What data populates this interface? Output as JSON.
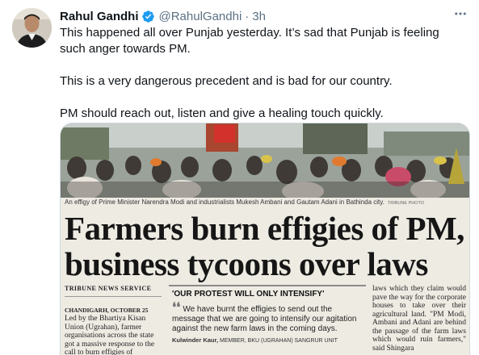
{
  "tweet": {
    "author": {
      "display_name": "Rahul Gandhi",
      "handle": "@RahulGandhi",
      "verified_icon": "verified-badge-icon",
      "verified_color": "#1d9bf0"
    },
    "separator": "·",
    "timestamp": "3h",
    "more_icon": "more-horizontal-icon",
    "paragraphs": [
      "This happened all over Punjab yesterday. It’s sad that Punjab is feeling such anger towards PM.",
      "This is a very dangerous precedent and is bad for our country.",
      "PM should reach out, listen and give a healing touch quickly."
    ]
  },
  "media": {
    "caption": "An effigy of Prime Minister Narendra Modi and industrialists Mukesh Ambani and Gautam Adani in Bathinda city.",
    "credit": "TRIBUNE PHOTO",
    "headline_line1": "Farmers burn effigies of PM,",
    "headline_line2": "business tycoons over laws",
    "byline": "TRIBUNE NEWS SERVICE",
    "left_column": {
      "dateline": "CHANDIGARH, OCTOBER 25",
      "text": "Led by the Bhartiya Kisan Union (Ugrahan), farmer organisations across the state got a massive response to the call to burn effigies of"
    },
    "quote_box": {
      "title": "'OUR PROTEST WILL ONLY INTENSIFY'",
      "quote": "We have burnt the effigies to send out the message that we are going to intensify our agitation against the new farm laws in the coming days.",
      "attribution_name": "Kulwinder Kaur,",
      "attribution_role": "MEMBER, BKU (UGRAHAN) SANGRUR UNIT"
    },
    "right_column": {
      "text": "laws which they claim would pave the way for the corporate houses to take over their agricultural land. \"PM Modi, Ambani and Adani are behind the passage of the farm laws which would ruin farmers,\" said Shingara"
    }
  }
}
